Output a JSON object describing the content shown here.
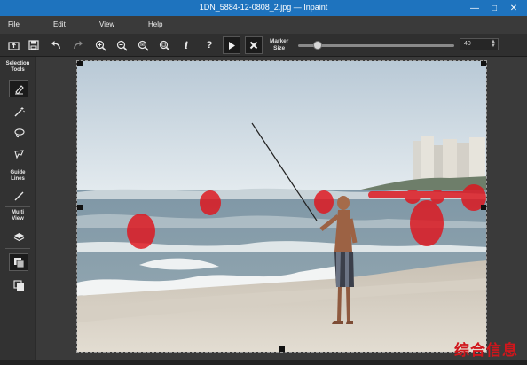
{
  "window": {
    "title": "1DN_5884-12-0808_2.jpg — Inpaint",
    "min_icon": "minimize-icon",
    "max_icon": "maximize-icon",
    "close_icon": "close-icon",
    "title_bar_color": "#1e73be"
  },
  "menu": {
    "items": [
      {
        "label": "File"
      },
      {
        "label": "Edit"
      },
      {
        "label": "View"
      },
      {
        "label": "Help"
      }
    ]
  },
  "toolbar": {
    "buttons": [
      {
        "icon": "open-image-icon"
      },
      {
        "icon": "save-icon"
      },
      {
        "icon": "undo-icon"
      },
      {
        "icon": "redo-icon"
      },
      {
        "icon": "zoom-in-icon"
      },
      {
        "icon": "zoom-out-icon"
      },
      {
        "icon": "zoom-actual-size-icon"
      },
      {
        "icon": "zoom-fit-icon"
      },
      {
        "icon": "info-icon",
        "glyph": "i"
      },
      {
        "icon": "help-icon",
        "glyph": "?"
      },
      {
        "icon": "run-inpaint-icon"
      },
      {
        "icon": "clear-selection-icon"
      }
    ],
    "marker_label_line1": "Marker",
    "marker_label_line2": "Size",
    "marker_size_value": "40",
    "marker_slider_fraction": 0.1
  },
  "left_panel": {
    "selection_tools_line1": "Selection",
    "selection_tools_line2": "Tools",
    "guide_lines_line1": "Guide",
    "guide_lines_line2": "Lines",
    "multi_view_line1": "Multi",
    "multi_view_line2": "View",
    "tools": [
      {
        "icon": "marker-icon",
        "active": true
      },
      {
        "icon": "magic-wand-icon",
        "active": false
      },
      {
        "icon": "lasso-icon",
        "active": false
      },
      {
        "icon": "polygon-lasso-icon",
        "active": false
      },
      {
        "icon": "guide-line-icon",
        "active": false
      },
      {
        "icon": "layers-icon",
        "active": false
      },
      {
        "icon": "view-side-by-side-icon",
        "active": true
      },
      {
        "icon": "view-overlay-icon",
        "active": false
      }
    ]
  },
  "canvas": {
    "image_description_icon": "beach-fishing-photo",
    "mask_color": "#e0141c"
  },
  "watermark": {
    "text": "综合信息"
  }
}
